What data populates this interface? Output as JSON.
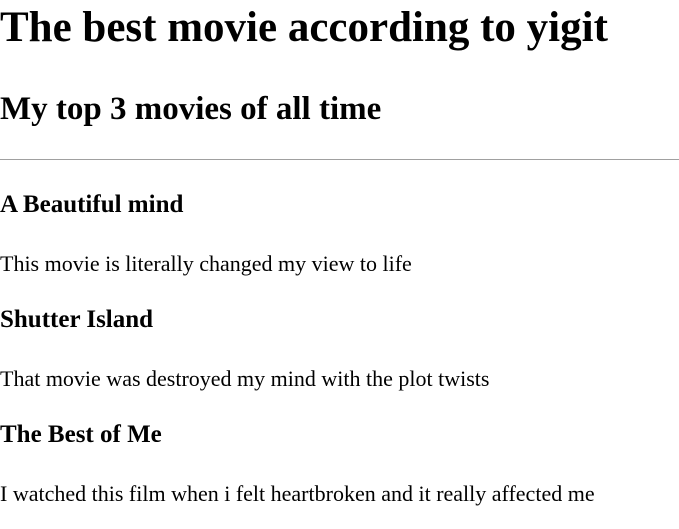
{
  "page": {
    "title": "The best movie according to yigit",
    "subtitle": "My top 3 movies of all time"
  },
  "movies": [
    {
      "title": "A Beautiful mind",
      "description": "This movie is literally changed my view to life"
    },
    {
      "title": "Shutter Island",
      "description": "That movie was destroyed my mind with the plot twists"
    },
    {
      "title": "The Best of Me",
      "description": "I watched this film when i felt heartbroken and it really affected me"
    }
  ]
}
